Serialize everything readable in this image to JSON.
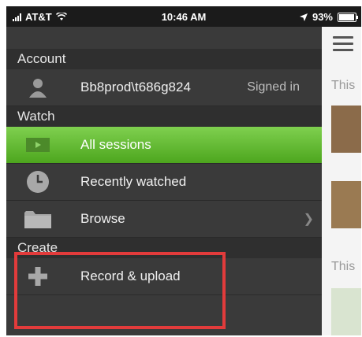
{
  "status_bar": {
    "carrier": "AT&T",
    "time": "10:46 AM",
    "battery_text": "93%",
    "battery_level": 0.93
  },
  "menu": {
    "account_header": "Account",
    "account": {
      "user": "Bb8prod\\t686g824",
      "status": "Signed in"
    },
    "watch_header": "Watch",
    "watch_items": [
      {
        "label": "All sessions",
        "icon": "video-icon",
        "active": true
      },
      {
        "label": "Recently watched",
        "icon": "clock-icon",
        "active": false
      },
      {
        "label": "Browse",
        "icon": "folder-icon",
        "active": false
      }
    ],
    "create_header": "Create",
    "create_items": [
      {
        "label": "Record & upload",
        "icon": "plus-icon"
      }
    ]
  },
  "content_peek": {
    "text_1": "This",
    "text_2": "This"
  },
  "colors": {
    "active_green": "#5cb82c",
    "highlight_red": "#e23b3b",
    "menu_bg": "#3a3a3a"
  }
}
